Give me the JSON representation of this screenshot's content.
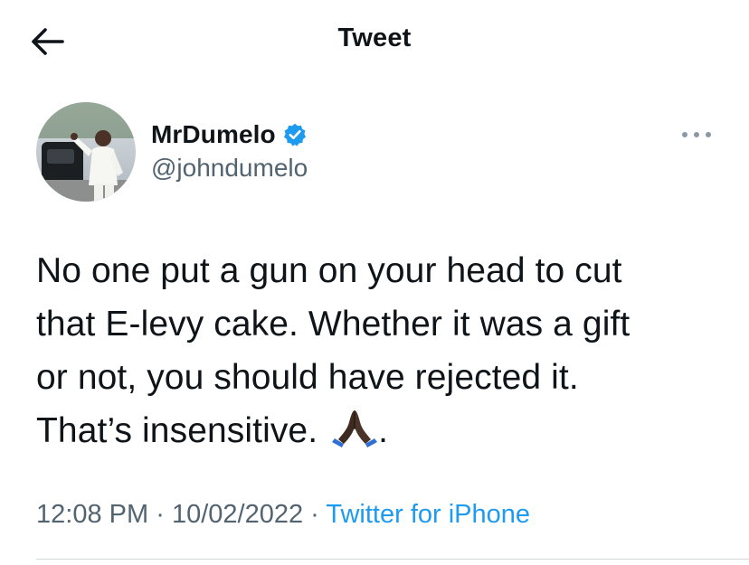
{
  "header": {
    "title": "Tweet",
    "back_icon": "arrow-left-icon"
  },
  "author": {
    "display_name": "MrDumelo",
    "handle": "@johndumelo",
    "verified": true,
    "verified_color": "#1d9bf0"
  },
  "tweet": {
    "lines": [
      "No one put a gun on your head to cut",
      "that E-levy cake. Whether it was a gift",
      "or not, you should have rejected it.",
      "That’s insensitive."
    ],
    "trailing_punctuation": ".",
    "emoji": "folded-hands-emoji"
  },
  "meta": {
    "time": "12:08 PM",
    "separator": "·",
    "date": "10/02/2022",
    "source": "Twitter for iPhone"
  },
  "colors": {
    "text": "#0f1419",
    "secondary": "#536471",
    "link": "#1d9bf0",
    "divider": "#cfd9de"
  }
}
